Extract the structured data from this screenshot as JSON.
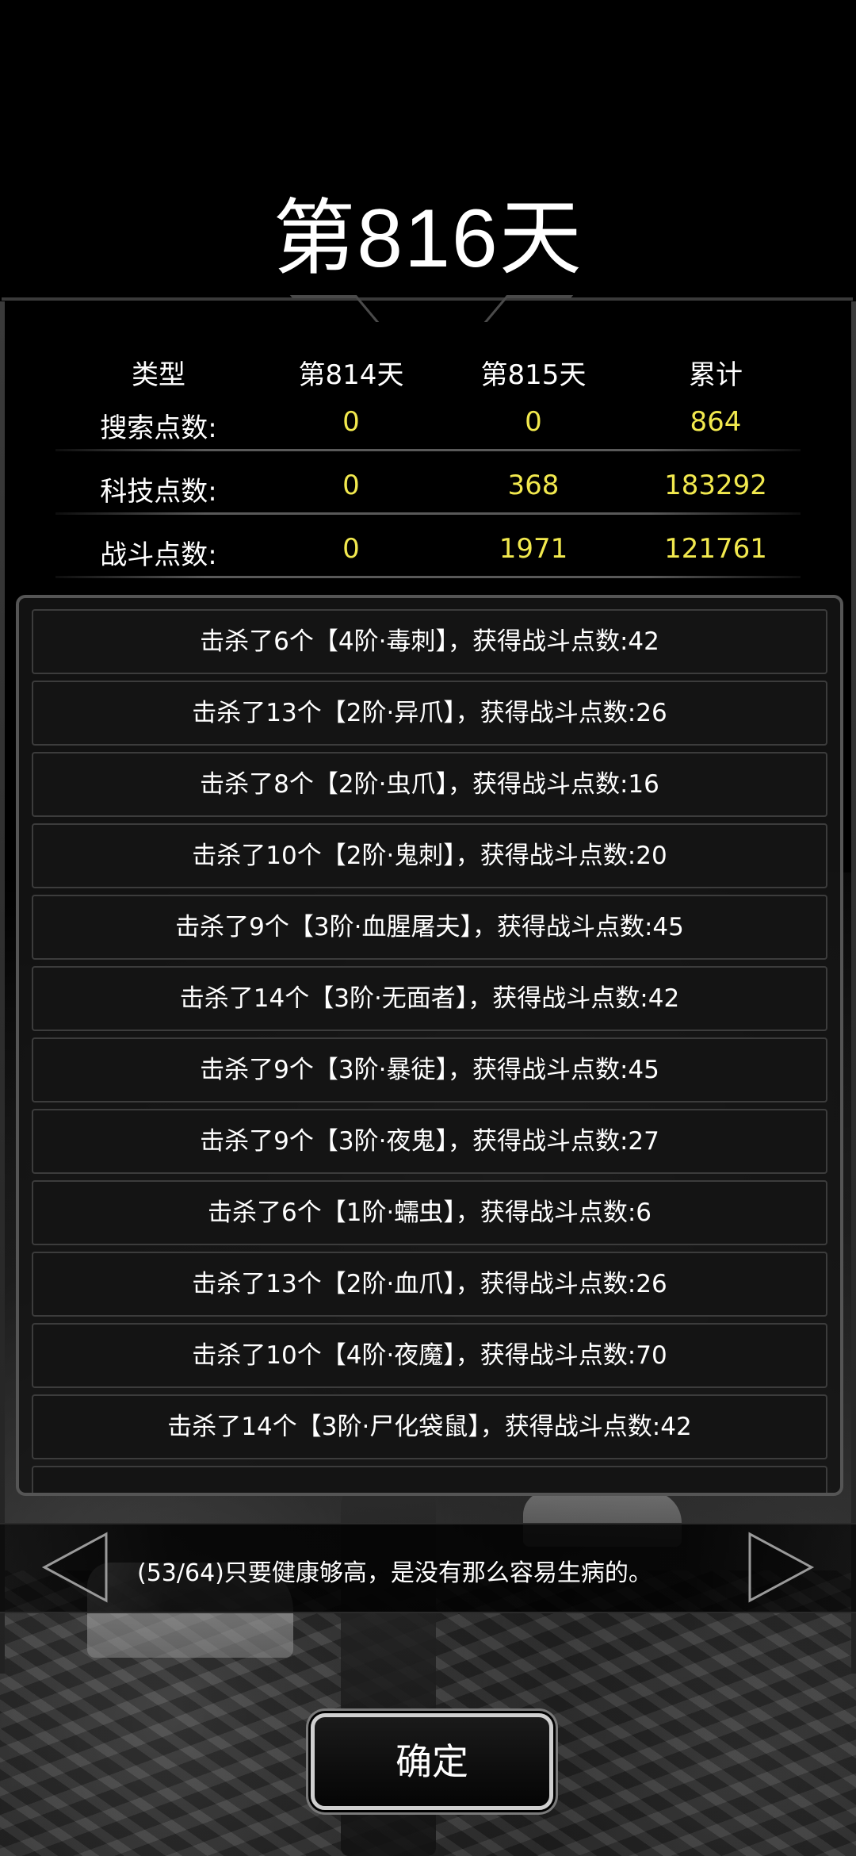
{
  "title": "第816天",
  "stats": {
    "headers": [
      "类型",
      "第814天",
      "第815天",
      "累计"
    ],
    "rows": [
      {
        "label": "搜索点数:",
        "d814": "0",
        "d815": "0",
        "total": "864"
      },
      {
        "label": "科技点数:",
        "d814": "0",
        "d815": "368",
        "total": "183292"
      },
      {
        "label": "战斗点数:",
        "d814": "0",
        "d815": "1971",
        "total": "121761"
      }
    ]
  },
  "log": [
    "击杀了6个【4阶·毒刺】，获得战斗点数:42",
    "击杀了13个【2阶·异爪】，获得战斗点数:26",
    "击杀了8个【2阶·虫爪】，获得战斗点数:16",
    "击杀了10个【2阶·鬼刺】，获得战斗点数:20",
    "击杀了9个【3阶·血腥屠夫】，获得战斗点数:45",
    "击杀了14个【3阶·无面者】，获得战斗点数:42",
    "击杀了9个【3阶·暴徒】，获得战斗点数:45",
    "击杀了9个【3阶·夜鬼】，获得战斗点数:27",
    "击杀了6个【1阶·蠕虫】，获得战斗点数:6",
    "击杀了13个【2阶·血爪】，获得战斗点数:26",
    "击杀了10个【4阶·夜魔】，获得战斗点数:70",
    "击杀了14个【3阶·尸化袋鼠】，获得战斗点数:42"
  ],
  "tip": {
    "text": "(53/64)只要健康够高，是没有那么容易生病的。",
    "prev_icon": "triangle-left-icon",
    "next_icon": "triangle-right-icon"
  },
  "confirm_label": "确定",
  "colors": {
    "value_yellow": "#f2e94e",
    "background": "#000000"
  }
}
